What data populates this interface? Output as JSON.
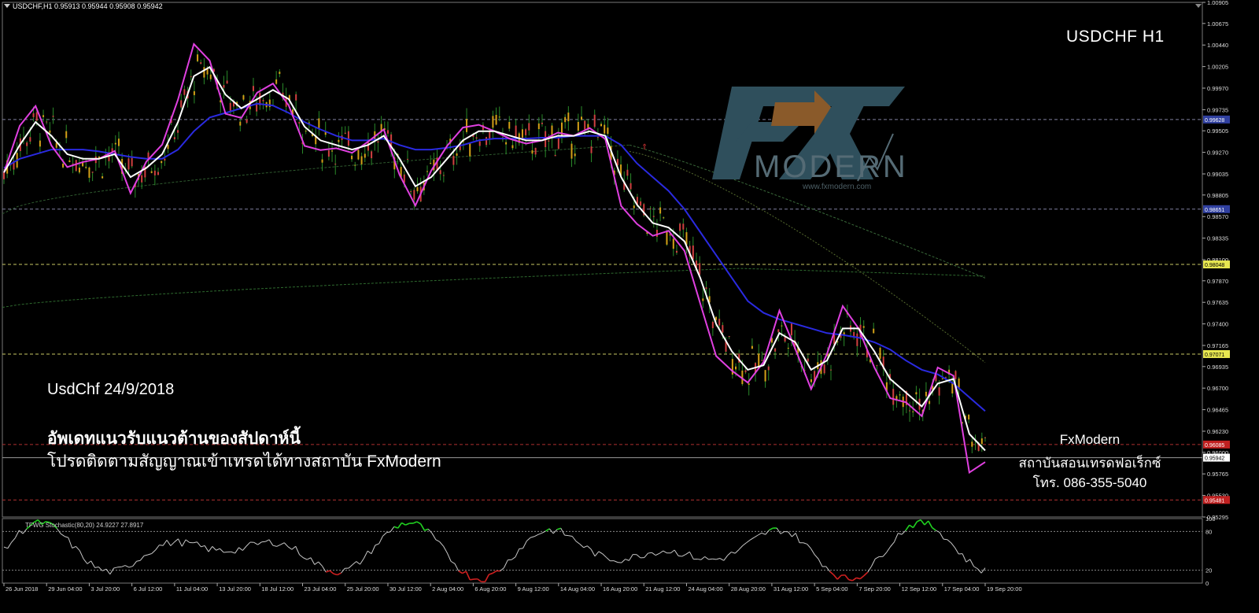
{
  "header": {
    "symbol_line": "USDCHF,H1  0.95913 0.95944 0.95908 0.95942"
  },
  "overlay": {
    "title": "USDCHF H1",
    "date_text": "UsdChf 24/9/2018",
    "thai_line1": "อัพเดทแนวรับแนวต้านของสัปดาห์นี้",
    "thai_line2": "โปรดติดตามสัญญาณเข้าเทรดได้ทางสถาบัน FxModern",
    "contact_name": "FxModern",
    "contact_institute": "สถาบันสอนเทรดฟอเร็กซ์",
    "contact_phone": "โทร. 086-355-5040"
  },
  "logo": {
    "text": "MODERN",
    "url": "www.fxmodern.com",
    "fx_color": "#2f4f5c",
    "arrow_color": "#8a5a2a"
  },
  "oscillator": {
    "label": "TFWG Stochastic(80,20) 24.9227 27.8917",
    "levels": [
      "100",
      "80",
      "20",
      "0"
    ]
  },
  "colors": {
    "background": "#000000",
    "bull_candle": "#d4a017",
    "bear_candle": "#d04040",
    "wick_green": "#2a8a2a",
    "ma_fast": "#e040e0",
    "ma_mid": "#ffffff",
    "ma_slow": "#2a2ae0",
    "level_line": "#8080a0",
    "support_yellow": "#c8c864",
    "support_red": "#b03030",
    "osc_line": "#c8c8c8",
    "osc_over": "#20d020",
    "osc_under": "#d02020"
  },
  "chart_data": {
    "type": "candlestick",
    "title": "USDCHF H1",
    "ylim": [
      0.95295,
      1.00905
    ],
    "y_ticks": [
      "1.00905",
      "1.00675",
      "1.00440",
      "1.00205",
      "0.99970",
      "0.99735",
      "0.99505",
      "0.99270",
      "0.99035",
      "0.98805",
      "0.98570",
      "0.98335",
      "0.98100",
      "0.97870",
      "0.97635",
      "0.97400",
      "0.97165",
      "0.96935",
      "0.96700",
      "0.96465",
      "0.96230",
      "0.96000",
      "0.95765",
      "0.95530",
      "0.95295"
    ],
    "x_ticks": [
      "26 Jun 2018",
      "29 Jun 04:00",
      "3 Jul 20:00",
      "6 Jul 12:00",
      "11 Jul 04:00",
      "13 Jul 20:00",
      "18 Jul 12:00",
      "23 Jul 04:00",
      "25 Jul 20:00",
      "30 Jul 12:00",
      "2 Aug 04:00",
      "6 Aug 20:00",
      "9 Aug 12:00",
      "14 Aug 04:00",
      "16 Aug 20:00",
      "21 Aug 12:00",
      "24 Aug 04:00",
      "28 Aug 20:00",
      "31 Aug 12:00",
      "5 Sep 04:00",
      "7 Sep 20:00",
      "12 Sep 12:00",
      "17 Sep 04:00",
      "19 Sep 20:00"
    ],
    "price_labels": [
      {
        "value": "0.99628",
        "style": "blue"
      },
      {
        "value": "0.98651",
        "style": "blue"
      },
      {
        "value": "0.98048",
        "style": "yellow"
      },
      {
        "value": "0.97071",
        "style": "yellow"
      },
      {
        "value": "0.96085",
        "style": "red"
      },
      {
        "value": "0.95942",
        "style": "current"
      },
      {
        "value": "0.95481",
        "style": "red"
      }
    ],
    "series": [
      {
        "name": "white_ma",
        "values": [
          0.9905,
          0.9935,
          0.996,
          0.9945,
          0.9925,
          0.992,
          0.992,
          0.9925,
          0.99,
          0.991,
          0.9925,
          0.996,
          1.001,
          1.002,
          0.999,
          0.9975,
          0.9985,
          0.9995,
          0.9985,
          0.9955,
          0.994,
          0.9935,
          0.993,
          0.9935,
          0.9945,
          0.992,
          0.989,
          0.99,
          0.992,
          0.994,
          0.995,
          0.995,
          0.9945,
          0.994,
          0.994,
          0.9945,
          0.9945,
          0.995,
          0.9945,
          0.99,
          0.987,
          0.985,
          0.9845,
          0.983,
          0.979,
          0.974,
          0.971,
          0.969,
          0.9695,
          0.973,
          0.972,
          0.969,
          0.97,
          0.9735,
          0.9735,
          0.971,
          0.968,
          0.9665,
          0.965,
          0.9675,
          0.968,
          0.962,
          0.9602
        ]
      },
      {
        "name": "blue_ma",
        "values": [
          0.991,
          0.992,
          0.9925,
          0.993,
          0.993,
          0.993,
          0.9928,
          0.9925,
          0.9922,
          0.992,
          0.992,
          0.993,
          0.995,
          0.9965,
          0.997,
          0.9975,
          0.998,
          0.9978,
          0.997,
          0.996,
          0.9952,
          0.9945,
          0.994,
          0.994,
          0.9942,
          0.9935,
          0.993,
          0.993,
          0.9932,
          0.9935,
          0.994,
          0.9942,
          0.9942,
          0.9942,
          0.9943,
          0.9943,
          0.9945,
          0.9945,
          0.9945,
          0.9935,
          0.9915,
          0.99,
          0.9885,
          0.9865,
          0.984,
          0.9815,
          0.979,
          0.9765,
          0.9752,
          0.9745,
          0.974,
          0.9735,
          0.973,
          0.9728,
          0.9725,
          0.972,
          0.9712,
          0.97,
          0.969,
          0.9685,
          0.9675,
          0.966,
          0.9645
        ]
      }
    ]
  }
}
